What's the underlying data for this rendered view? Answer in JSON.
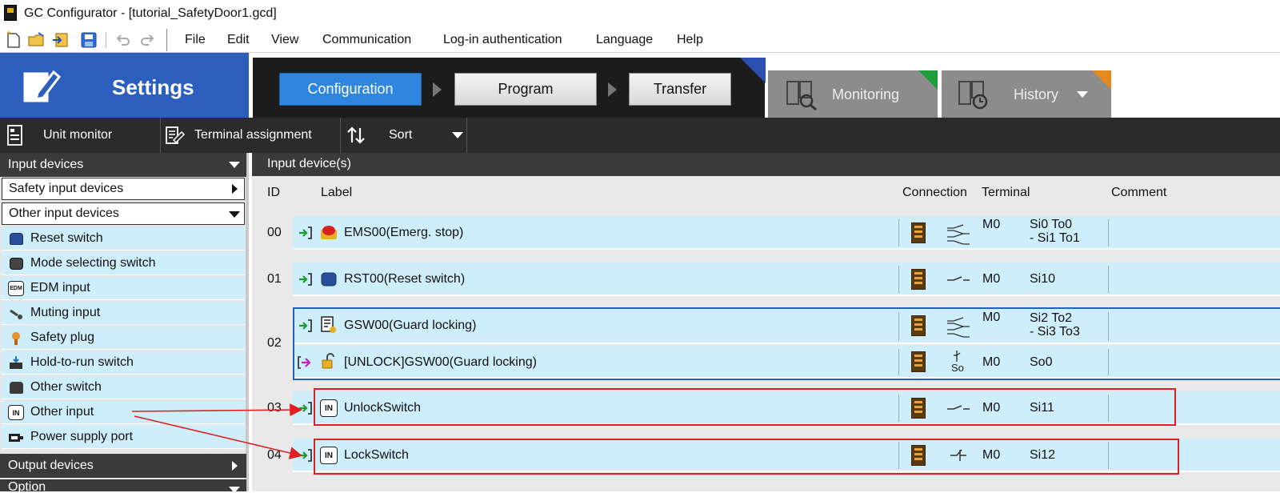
{
  "window": {
    "title": "GC Configurator - [tutorial_SafetyDoor1.gcd]"
  },
  "toolbar_icons": [
    "new-file-icon",
    "open-folder-icon",
    "import-icon",
    "save-icon",
    "undo-icon",
    "redo-icon"
  ],
  "menu": {
    "items": [
      {
        "label": "File"
      },
      {
        "label": "Edit"
      },
      {
        "label": "View"
      },
      {
        "label": "Communication"
      },
      {
        "label": "Log-in authentication"
      },
      {
        "label": "Language"
      },
      {
        "label": "Help"
      }
    ]
  },
  "header": {
    "mode": "Settings",
    "workflow": {
      "steps": [
        {
          "label": "Configuration",
          "active": true
        },
        {
          "label": "Program",
          "active": false
        },
        {
          "label": "Transfer",
          "active": false
        }
      ]
    },
    "tabs": [
      {
        "label": "Monitoring"
      },
      {
        "label": "History"
      }
    ]
  },
  "tool_row": {
    "unit_monitor": "Unit monitor",
    "terminal_assignment": "Terminal assignment",
    "sort": "Sort"
  },
  "sidebar": {
    "input_devices": "Input devices",
    "safety_input_devices": "Safety input devices",
    "other_input_devices": "Other input devices",
    "items": [
      {
        "label": "Reset switch",
        "icon": "reset-switch-icon"
      },
      {
        "label": "Mode selecting switch",
        "icon": "mode-switch-icon"
      },
      {
        "label": "EDM input",
        "icon": "edm-icon",
        "icon_text": "EDM"
      },
      {
        "label": "Muting input",
        "icon": "muting-icon"
      },
      {
        "label": "Safety plug",
        "icon": "safety-plug-icon"
      },
      {
        "label": "Hold-to-run switch",
        "icon": "hold-to-run-icon"
      },
      {
        "label": "Other switch",
        "icon": "other-switch-icon"
      },
      {
        "label": "Other input",
        "icon": "in-icon",
        "icon_text": "IN"
      },
      {
        "label": "Power supply port",
        "icon": "power-port-icon"
      }
    ],
    "output_devices": "Output devices",
    "option": "Option"
  },
  "main": {
    "title": "Input device(s)",
    "columns": {
      "id": "ID",
      "label": "Label",
      "connection": "Connection",
      "terminal": "Terminal",
      "comment": "Comment"
    },
    "rows": [
      {
        "id": "00",
        "label": "EMS00(Emerg. stop)",
        "module": "M0",
        "terminal_line1": "Si0 To0",
        "terminal_line2": "- Si1 To1"
      },
      {
        "id": "01",
        "label": "RST00(Reset switch)",
        "module": "M0",
        "terminal_line1": "Si10",
        "terminal_line2": ""
      },
      {
        "id": "02",
        "label": "GSW00(Guard locking)",
        "module": "M0",
        "terminal_line1": "Si2 To2",
        "terminal_line2": "- Si3 To3"
      },
      {
        "id": "",
        "label": "[UNLOCK]GSW00(Guard locking)",
        "module": "M0",
        "terminal_line1": "So0",
        "terminal_line2": ""
      },
      {
        "id": "03",
        "label": "UnlockSwitch",
        "module": "M0",
        "terminal_line1": "Si11",
        "terminal_line2": ""
      },
      {
        "id": "04",
        "label": "LockSwitch",
        "module": "M0",
        "terminal_line1": "Si12",
        "terminal_line2": ""
      }
    ],
    "icon_texts": {
      "in": "IN",
      "so": "So"
    }
  },
  "colors": {
    "settings_blue": "#2c5fbd",
    "active_step": "#2e86de",
    "row_bg": "#cfeefb",
    "group_border": "#1f5fc8",
    "annotation_red": "#e02020",
    "monitor_corner": "#1f9d3a",
    "history_corner": "#e58a1f"
  }
}
